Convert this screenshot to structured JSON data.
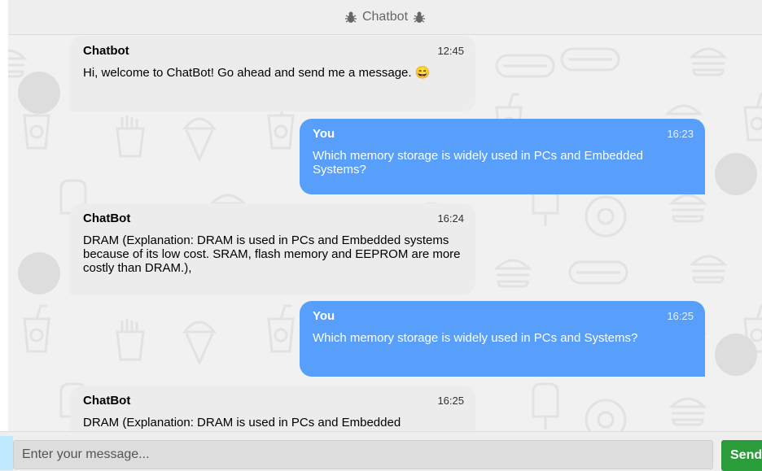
{
  "header": {
    "title": "Chatbot",
    "icon_left": "bug-icon",
    "icon_right": "bug-icon"
  },
  "messages": [
    {
      "sender": "Chatbot",
      "time": "12:45",
      "side": "left",
      "text": "Hi, welcome to ChatBot! Go ahead and send me a message. 😄"
    },
    {
      "sender": "You",
      "time": "16:23",
      "side": "right",
      "text": "Which memory storage is widely used in PCs and Embedded Systems?"
    },
    {
      "sender": "ChatBot",
      "time": "16:24",
      "side": "left",
      "text": "DRAM (Explanation: DRAM is used in PCs and Embedded systems because of its low cost. SRAM, flash memory and EEPROM are more costly than DRAM.),"
    },
    {
      "sender": "You",
      "time": "16:25",
      "side": "right",
      "text": "Which memory storage is widely used in PCs and Systems?"
    },
    {
      "sender": "ChatBot",
      "time": "16:25",
      "side": "left",
      "text": "DRAM (Explanation: DRAM is used in PCs and Embedded"
    }
  ],
  "input": {
    "placeholder": "Enter your message...",
    "value": ""
  },
  "send_button": {
    "label": "Send"
  },
  "colors": {
    "user_bubble": "#579ffb",
    "bot_bubble": "#ececec",
    "send_button": "#2a9d3a",
    "background": "#f1f1f1"
  }
}
